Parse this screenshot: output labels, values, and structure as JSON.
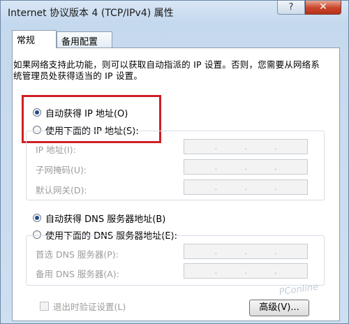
{
  "window": {
    "title": "Internet 协议版本 4 (TCP/IPv4) 属性",
    "help_label": "?",
    "close_label": "✕"
  },
  "tabs": [
    {
      "label": "常规",
      "active": true
    },
    {
      "label": "备用配置",
      "active": false
    }
  ],
  "description": "如果网络支持此功能，则可以获取自动指派的 IP 设置。否则，您需要从网络系统管理员处获得适当的 IP 设置。",
  "ip_mode": {
    "auto_label": "自动获得 IP 地址(O)",
    "manual_label": "使用下面的 IP 地址(S):",
    "selected": "auto"
  },
  "ip_fields": [
    {
      "label": "IP 地址(I):",
      "value": ". . ."
    },
    {
      "label": "子网掩码(U):",
      "value": ". . ."
    },
    {
      "label": "默认网关(D):",
      "value": ". . ."
    }
  ],
  "dns_mode": {
    "auto_label": "自动获得 DNS 服务器地址(B)",
    "manual_label": "使用下面的 DNS 服务器地址(E):",
    "selected": "auto"
  },
  "dns_fields": [
    {
      "label": "首选 DNS 服务器(P):",
      "value": ". . ."
    },
    {
      "label": "备用 DNS 服务器(A):",
      "value": ". . ."
    }
  ],
  "validate_on_exit": {
    "label": "退出时验证设置(L)",
    "checked": false
  },
  "advanced_button": "高级(V)...",
  "watermark": "PConline",
  "colors": {
    "highlight": "#cf1f24",
    "title_bar": "#c9dcef"
  }
}
